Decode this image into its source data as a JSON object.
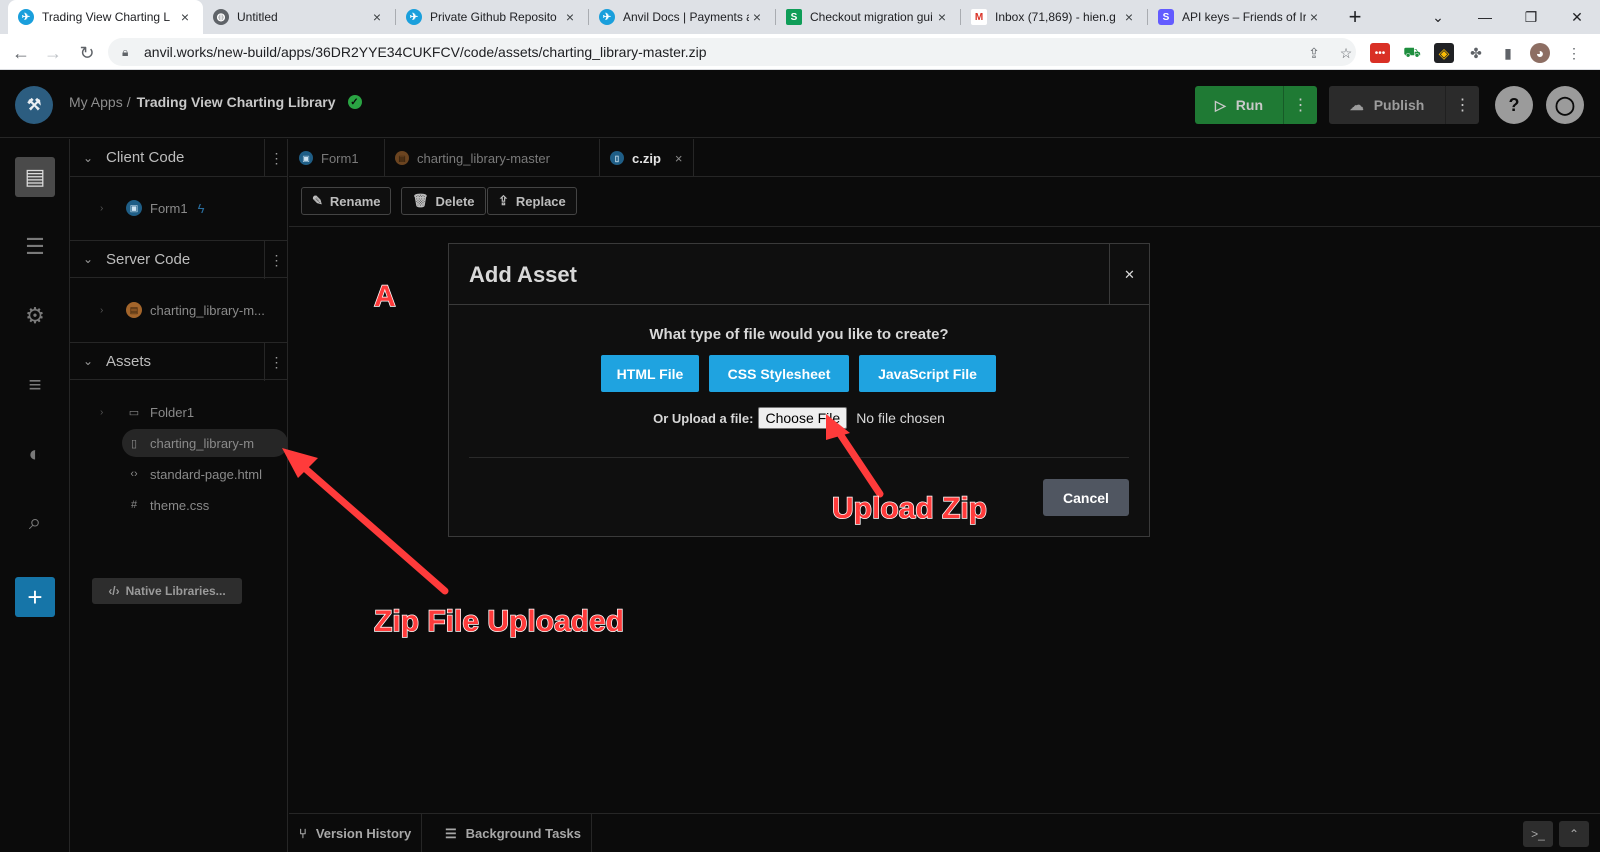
{
  "browser": {
    "tabs": [
      {
        "title": "Trading View Charting L",
        "icon": "anvil-icon",
        "active": true
      },
      {
        "title": "Untitled",
        "icon": "globe-icon",
        "active": false
      },
      {
        "title": "Private Github Reposito",
        "icon": "anvil-icon",
        "active": false
      },
      {
        "title": "Anvil Docs | Payments a",
        "icon": "anvil-icon",
        "active": false
      },
      {
        "title": "Checkout migration gui",
        "icon": "sheets-icon",
        "active": false
      },
      {
        "title": "Inbox (71,869) - hien.g",
        "icon": "gmail-icon",
        "active": false
      },
      {
        "title": "API keys – Friends of Irc",
        "icon": "stripe-icon",
        "active": false
      }
    ],
    "url": "anvil.works/new-build/apps/36DR2YYE34CUKFCV/code/assets/charting_library-master.zip",
    "extension_badge": "2"
  },
  "header": {
    "crumb_root": "My Apps",
    "crumb_sep": "/",
    "app_name": "Trading View Charting Library",
    "run_label": "Run",
    "publish_label": "Publish"
  },
  "explorer": {
    "client_code": {
      "title": "Client Code",
      "items": [
        {
          "label": "Form1"
        }
      ]
    },
    "server_code": {
      "title": "Server Code",
      "items": [
        {
          "label": "charting_library-m..."
        }
      ]
    },
    "assets": {
      "title": "Assets",
      "items": [
        {
          "label": "Folder1",
          "icon": "folder-icon"
        },
        {
          "label": "charting_library-m",
          "icon": "file-icon",
          "selected": true
        },
        {
          "label": "standard-page.html",
          "icon": "code-icon"
        },
        {
          "label": "theme.css",
          "icon": "hash-icon"
        }
      ]
    },
    "native_libraries": "Native Libraries..."
  },
  "editor": {
    "tabs": [
      {
        "label": "Form1"
      },
      {
        "label": "charting_library-master"
      },
      {
        "label": "c.zip",
        "active": true
      }
    ],
    "toolbar": {
      "rename": "Rename",
      "delete": "Delete",
      "replace": "Replace"
    },
    "bottom": {
      "version_history": "Version History",
      "background_tasks": "Background Tasks"
    }
  },
  "modal": {
    "title": "Add Asset",
    "question": "What type of file would you like to create?",
    "buttons": {
      "html": "HTML File",
      "css": "CSS Stylesheet",
      "js": "JavaScript File"
    },
    "upload_label": "Or Upload a file:",
    "choose_file": "Choose File",
    "no_file": "No file chosen",
    "cancel": "Cancel"
  },
  "annotations": {
    "marker": "A",
    "upload_zip": "Upload Zip",
    "zip_uploaded": "Zip File Uploaded"
  },
  "colors": {
    "accent_blue": "#1fa3e0",
    "run_green": "#1f7a34",
    "annotation_red": "#ff3b3b"
  }
}
